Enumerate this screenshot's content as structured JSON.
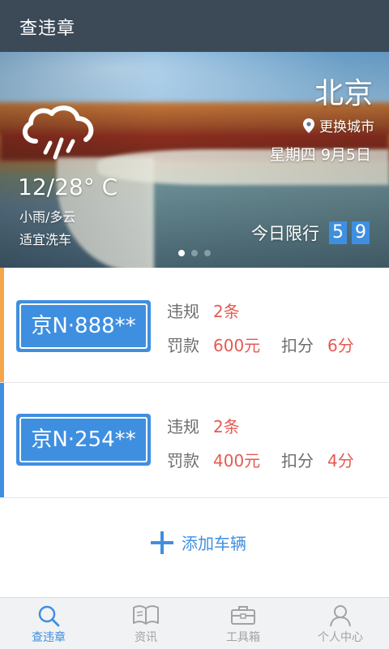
{
  "header": {
    "title": "查违章"
  },
  "weather": {
    "temperature": "12/28° C",
    "description": "小雨/多云",
    "suggestion": "适宜洗车",
    "icon": "rain-cloud-icon"
  },
  "location": {
    "city": "北京",
    "change_city_label": "更换城市",
    "date": "星期四  9月5日"
  },
  "traffic_limit": {
    "label": "今日限行",
    "numbers": [
      "5",
      "9"
    ]
  },
  "carousel": {
    "page_count": 3,
    "active_index": 0
  },
  "cars": [
    {
      "plate": "京N·888**",
      "violations_label": "违规",
      "violations_value": "2条",
      "fine_label": "罚款",
      "fine_value": "600元",
      "points_label": "扣分",
      "points_value": "6分",
      "accent_color": "#f5a54a"
    },
    {
      "plate": "京N·254**",
      "violations_label": "违规",
      "violations_value": "2条",
      "fine_label": "罚款",
      "fine_value": "400元",
      "points_label": "扣分",
      "points_value": "4分",
      "accent_color": "#3f8fe0"
    }
  ],
  "add_vehicle": {
    "label": "添加车辆"
  },
  "tabs": [
    {
      "label": "查违章",
      "icon": "search-icon",
      "active": true
    },
    {
      "label": "资讯",
      "icon": "book-icon",
      "active": false
    },
    {
      "label": "工具箱",
      "icon": "toolbox-icon",
      "active": false
    },
    {
      "label": "个人中心",
      "icon": "user-icon",
      "active": false
    }
  ],
  "colors": {
    "header_bg": "#3c4a58",
    "accent_blue": "#3f8fe0",
    "value_red": "#e55a53",
    "car1_stripe": "#f5a54a",
    "car2_stripe": "#3f8fe0"
  }
}
